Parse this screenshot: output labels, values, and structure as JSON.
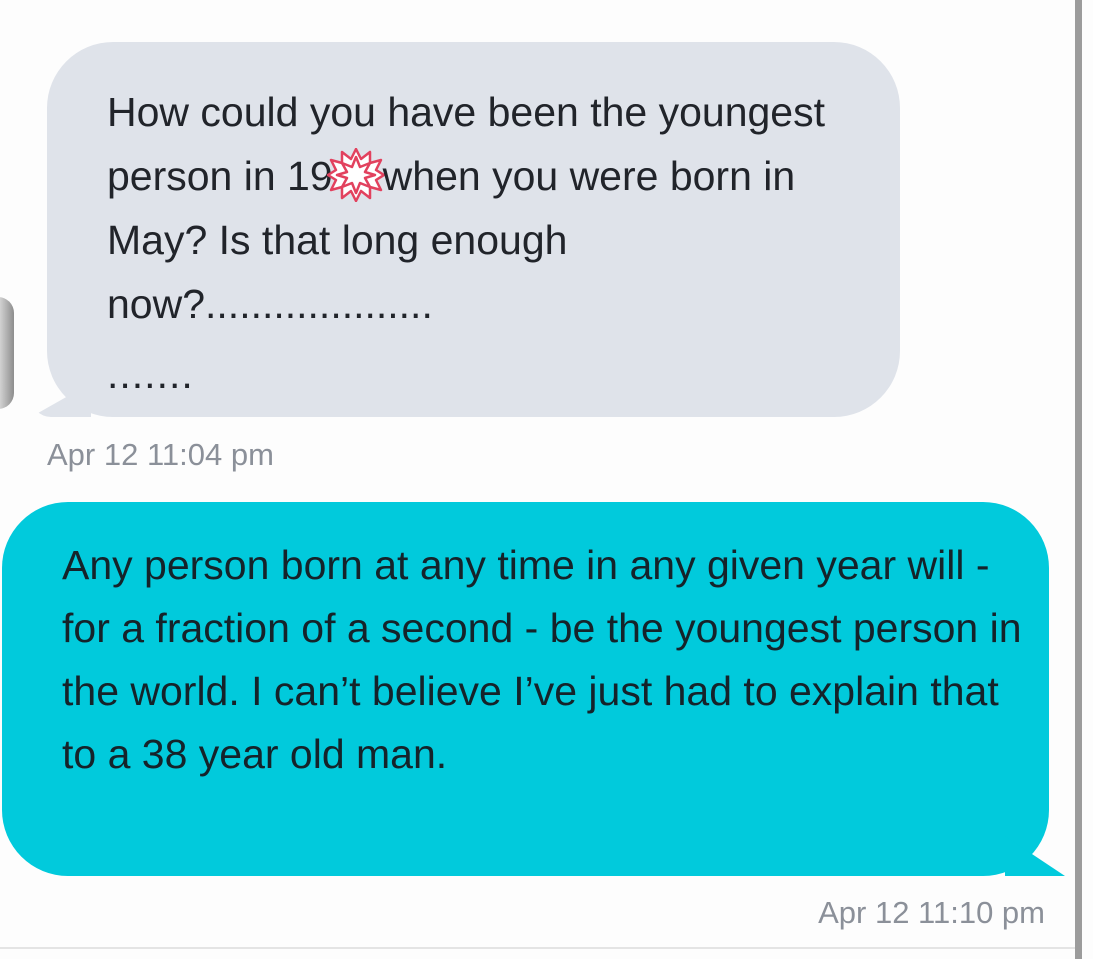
{
  "conversation": {
    "messages": [
      {
        "direction": "incoming",
        "text_before_redaction": "How could you have been the youngest person in 19",
        "redaction_icon": "red-star-burst-icon",
        "text_after_redaction": "when you were born in May? Is that long enough now?....................",
        "trailing_dots": ".......",
        "timestamp": "Apr 12 11:04 pm",
        "bubble_color": "#dfe3ea"
      },
      {
        "direction": "outgoing",
        "text": "Any person born at any time in any given year will - for a fraction of a second - be the youngest person in the world. I can’t believe I’ve just had to explain that to a 38 year old man.",
        "timestamp": "Apr 12 11:10 pm",
        "bubble_color": "#01cadc"
      }
    ]
  }
}
